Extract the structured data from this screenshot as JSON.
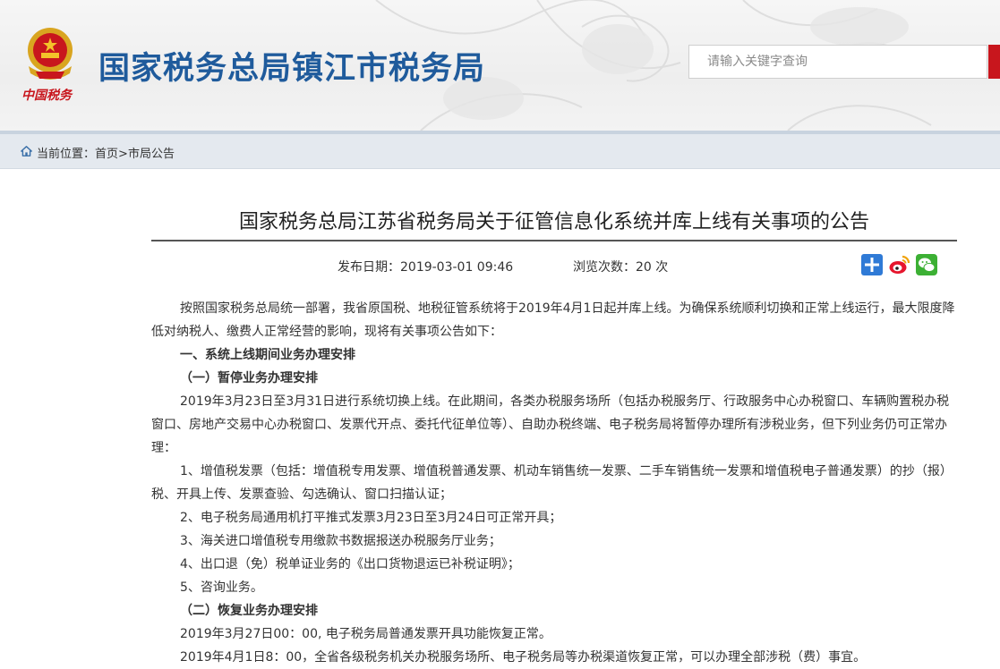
{
  "header": {
    "site_title": "国家税务总局镇江市税务局",
    "emblem_caption": "中国税务",
    "search": {
      "placeholder": "请输入关键字查询"
    }
  },
  "breadcrumb": {
    "prefix": "当前位置：",
    "items": [
      "首页",
      "市局公告"
    ],
    "separator": ">"
  },
  "article": {
    "title": "国家税务总局江苏省税务局关于征管信息化系统并库上线有关事项的公告",
    "publish_label": "发布日期：",
    "publish_date": "2019-03-01 09:46",
    "views_label": "浏览次数：",
    "views_value": "20",
    "views_unit": "次",
    "share_icons": [
      "share-plus-icon",
      "weibo-icon",
      "wechat-icon"
    ],
    "paragraphs": [
      {
        "text": "按照国家税务总局统一部署，我省原国税、地税征管系统将于2019年4月1日起并库上线。为确保系统顺利切换和正常上线运行，最大限度降低对纳税人、缴费人正常经营的影响，现将有关事项公告如下：",
        "bold": false
      },
      {
        "text": "一、系统上线期间业务办理安排",
        "bold": true
      },
      {
        "text": "（一）暂停业务办理安排",
        "bold": true
      },
      {
        "text": "2019年3月23日至3月31日进行系统切换上线。在此期间，各类办税服务场所（包括办税服务厅、行政服务中心办税窗口、车辆购置税办税窗口、房地产交易中心办税窗口、发票代开点、委托代征单位等）、自助办税终端、电子税务局将暂停办理所有涉税业务，但下列业务仍可正常办理：",
        "bold": false
      },
      {
        "text": "1、增值税发票（包括：增值税专用发票、增值税普通发票、机动车销售统一发票、二手车销售统一发票和增值税电子普通发票）的抄（报）税、开具上传、发票查验、勾选确认、窗口扫描认证；",
        "bold": false
      },
      {
        "text": "2、电子税务局通用机打平推式发票3月23日至3月24日可正常开具；",
        "bold": false
      },
      {
        "text": "3、海关进口增值税专用缴款书数据报送办税服务厅业务；",
        "bold": false
      },
      {
        "text": "4、出口退（免）税单证业务的《出口货物退运已补税证明》；",
        "bold": false
      },
      {
        "text": "5、咨询业务。",
        "bold": false
      },
      {
        "text": "（二）恢复业务办理安排",
        "bold": true
      },
      {
        "text": "2019年3月27日00：00, 电子税务局普通发票开具功能恢复正常。",
        "bold": false
      },
      {
        "text": "2019年4月1日8：00，全省各级税务机关办税服务场所、电子税务局等办税渠道恢复正常，可以办理全部涉税（费）事宜。",
        "bold": false
      }
    ]
  },
  "colors": {
    "title_blue": "#1f5b9c",
    "emblem_red": "#c8161d",
    "emblem_gold": "#d9a520",
    "breadcrumb_bg": "#e4e9ef"
  }
}
